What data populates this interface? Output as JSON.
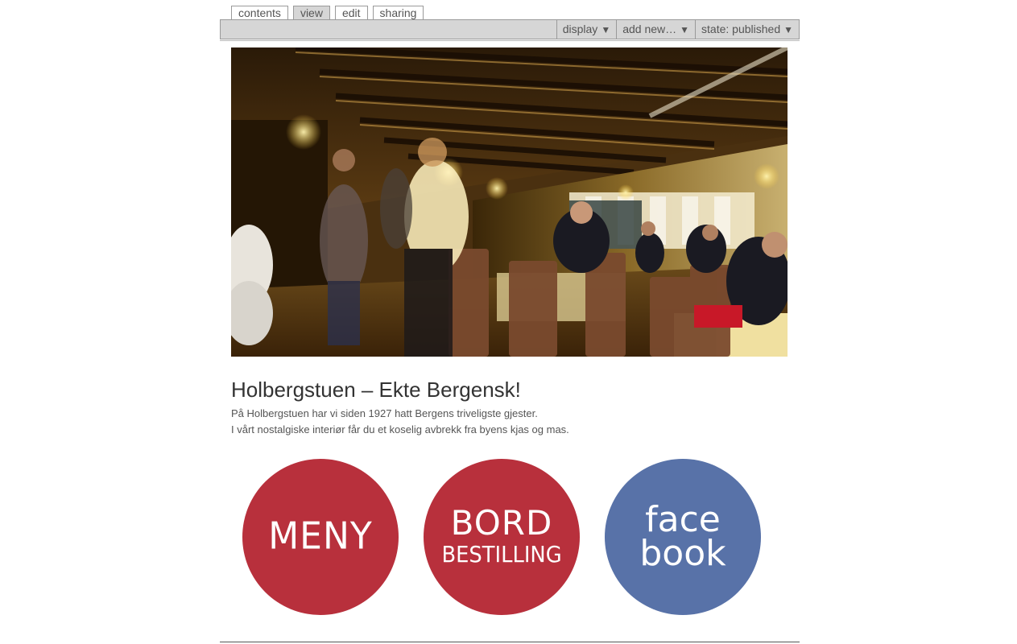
{
  "tabs": [
    {
      "label": "contents",
      "active": false
    },
    {
      "label": "view",
      "active": true
    },
    {
      "label": "edit",
      "active": false
    },
    {
      "label": "sharing",
      "active": false
    }
  ],
  "toolbar": {
    "display_label": "display",
    "add_new_label": "add new…",
    "state_label": "state: published",
    "arrow": "▼"
  },
  "hero": {
    "image_subject": "restaurant-interior-photo"
  },
  "main": {
    "title": "Holbergstuen – Ekte Bergensk!",
    "lines": [
      "På Holbergstuen har vi siden 1927 hatt Bergens triveligste gjester.",
      "I vårt nostalgiske interiør får du et koselig avbrekk fra byens kjas og mas."
    ]
  },
  "links": {
    "meny": {
      "text": "MENY",
      "color": "#b8303c"
    },
    "bord": {
      "line1": "BORD",
      "line2": "BESTILLING",
      "color": "#b8303c"
    },
    "facebook": {
      "line1": "face",
      "line2": "book",
      "color": "#5872a8"
    }
  },
  "colors": {
    "toolbar_bg": "#d6d6d6",
    "border": "#9a9a9a",
    "text": "#555555",
    "title": "#333333"
  }
}
